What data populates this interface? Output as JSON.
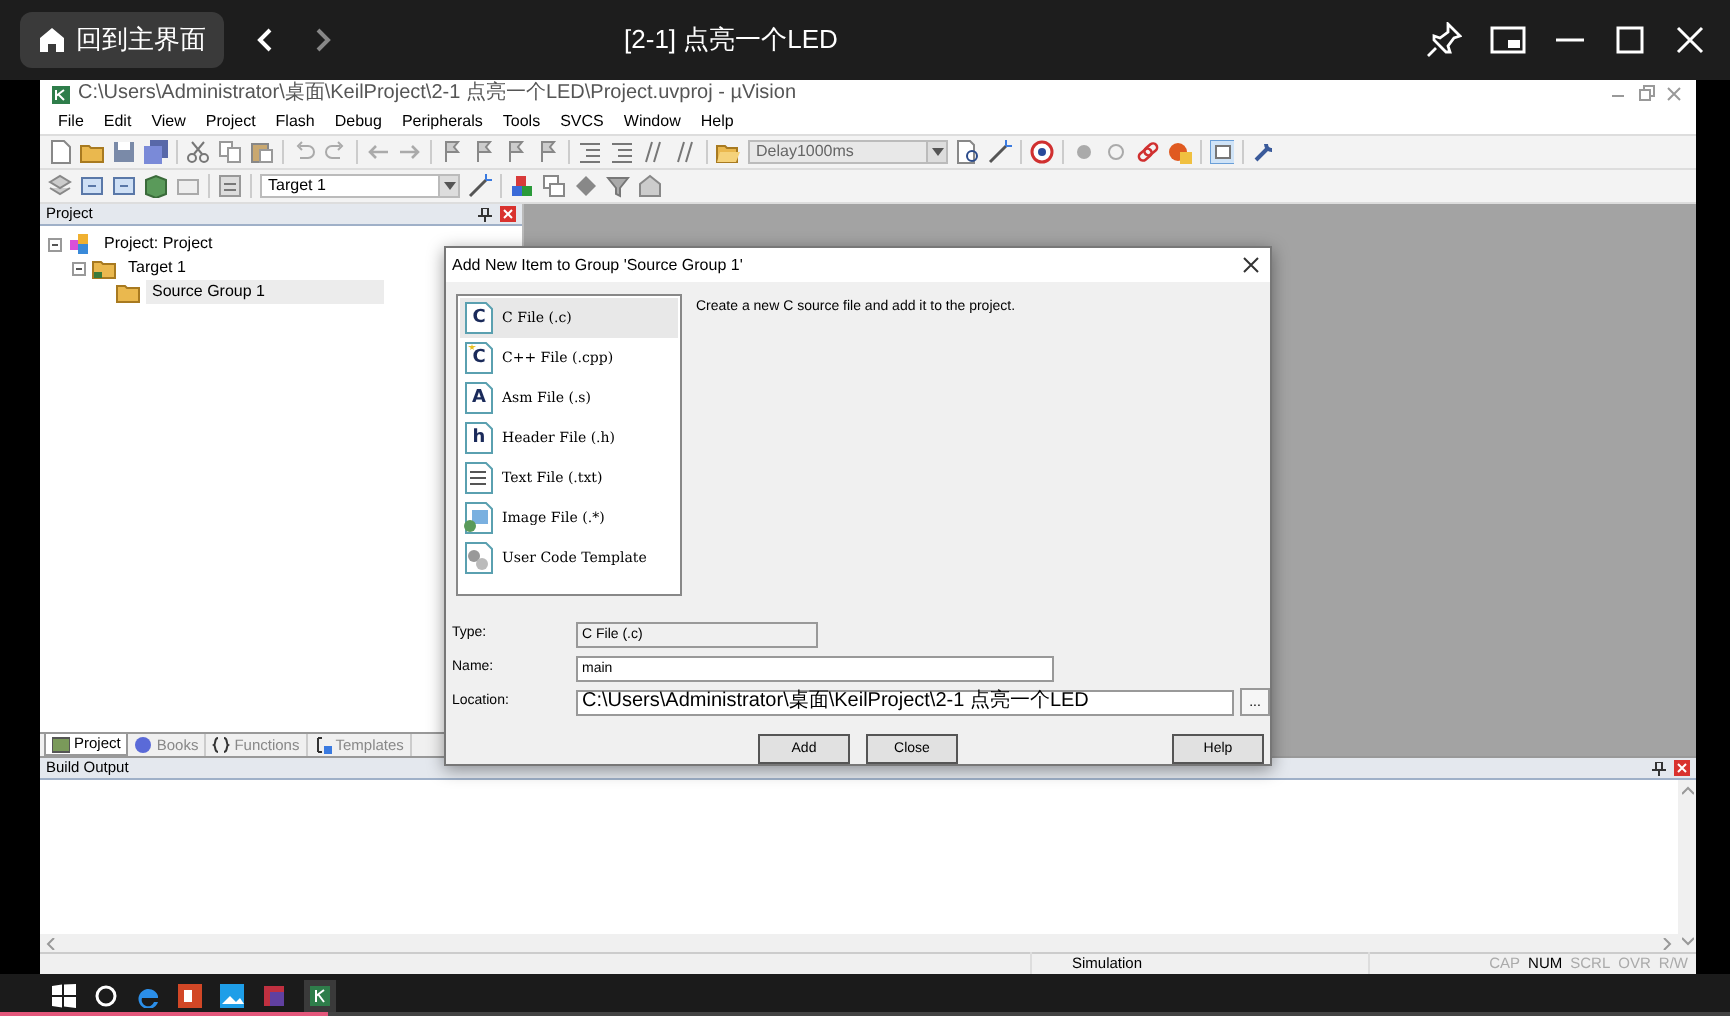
{
  "player": {
    "home_button": "回到主界面",
    "title": "[2-1] 点亮一个LED",
    "progress": {
      "level": 0.19
    }
  },
  "window": {
    "title": "C:\\Users\\Administrator\\桌面\\KeilProject\\2-1 点亮一个LED\\Project.uvproj - µVision"
  },
  "menu": [
    "File",
    "Edit",
    "View",
    "Project",
    "Flash",
    "Debug",
    "Peripherals",
    "Tools",
    "SVCS",
    "Window",
    "Help"
  ],
  "toolbar": {
    "find_combo": "Delay1000ms",
    "target_combo": "Target 1"
  },
  "project_panel": {
    "title": "Project",
    "tree": [
      {
        "label": "Project: Project",
        "expanded": true,
        "selected": false,
        "children": [
          {
            "label": "Target 1",
            "expanded": true,
            "selected": false,
            "children": [
              {
                "label": "Source Group 1",
                "selected": true
              }
            ]
          }
        ]
      }
    ],
    "tabs": [
      {
        "label": "Project",
        "selected": true
      },
      {
        "label": "Books",
        "selected": false
      },
      {
        "label": "Functions",
        "selected": false
      },
      {
        "label": "Templates",
        "selected": false
      }
    ]
  },
  "dialog": {
    "title": "Add New Item to Group 'Source Group 1'",
    "items": [
      {
        "kind": "c",
        "badge": "C",
        "label": "C File (.c)",
        "selected": true
      },
      {
        "kind": "cpp",
        "badge": "C",
        "label": "C++ File (.cpp)",
        "selected": false
      },
      {
        "kind": "asm",
        "badge": "A",
        "label": "Asm File (.s)",
        "selected": false
      },
      {
        "kind": "header",
        "badge": "h",
        "label": "Header File (.h)",
        "selected": false
      },
      {
        "kind": "text",
        "label": "Text File (.txt)",
        "selected": false
      },
      {
        "kind": "image",
        "label": "Image File (.*)",
        "selected": false
      },
      {
        "kind": "template",
        "label": "User Code Template",
        "selected": false
      }
    ],
    "description": "Create a new C source file and add it to the project.",
    "fields": [
      {
        "label": "Type:",
        "value": "C File (.c)",
        "readonly": true
      },
      {
        "label": "Name:",
        "value": "main",
        "readonly": false
      },
      {
        "label": "Location:",
        "value": "C:\\Users\\Administrator\\桌面\\KeilProject\\2-1 点亮一个LED",
        "readonly": false,
        "browse": "..."
      }
    ],
    "buttons": [
      "Add",
      "Close",
      "Help"
    ]
  },
  "build_output": {
    "title": "Build Output"
  },
  "status_bar": {
    "mode": "Simulation",
    "indicators": [
      {
        "label": "CAP",
        "on": false
      },
      {
        "label": "NUM",
        "on": true
      },
      {
        "label": "SCRL",
        "on": false
      },
      {
        "label": "OVR",
        "on": false
      },
      {
        "label": "R/W",
        "on": false
      }
    ]
  }
}
